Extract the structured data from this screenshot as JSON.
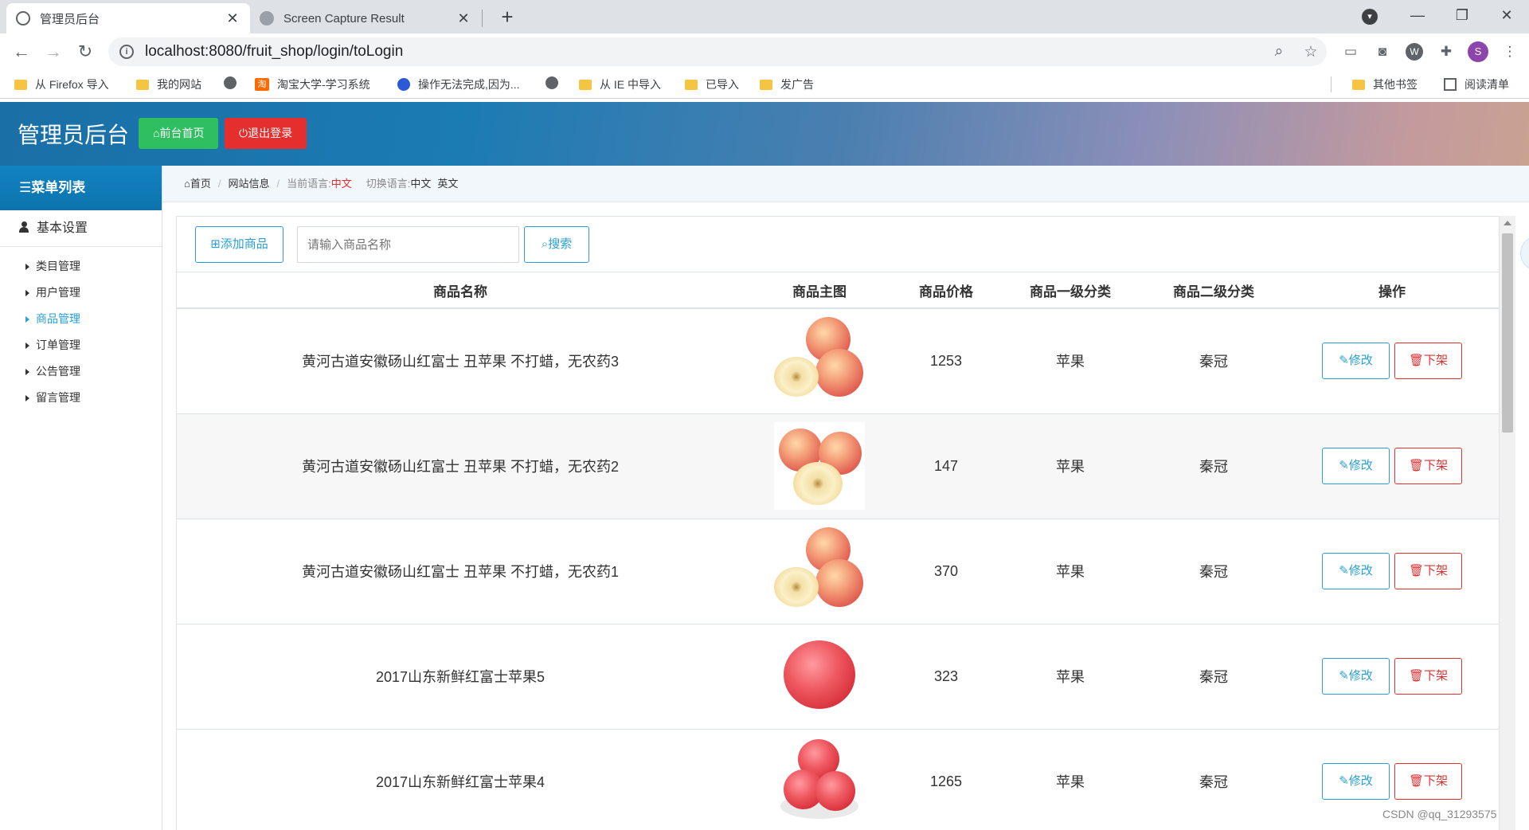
{
  "browser": {
    "tabs": [
      {
        "title": "管理员后台",
        "active": true
      },
      {
        "title": "Screen Capture Result",
        "active": false
      }
    ],
    "url": "localhost:8080/fruit_shop/login/toLogin",
    "bookmarks": [
      {
        "label": "从 Firefox 导入",
        "icon": "folder-icon"
      },
      {
        "label": "我的网站",
        "icon": "folder-icon"
      },
      {
        "label": "",
        "icon": "globe-icon"
      },
      {
        "label": "淘宝大学-学习系统",
        "icon": "taobao-icon"
      },
      {
        "label": "操作无法完成,因为...",
        "icon": "baidu-icon"
      },
      {
        "label": "",
        "icon": "globe-icon"
      },
      {
        "label": "从 IE 中导入",
        "icon": "folder-icon"
      },
      {
        "label": "已导入",
        "icon": "folder-icon"
      },
      {
        "label": "发广告",
        "icon": "folder-icon"
      }
    ],
    "other_bookmarks": "其他书签",
    "reading_list": "阅读清单",
    "profile_initial": "S"
  },
  "header": {
    "brand": "管理员后台",
    "home_button": "前台首页",
    "logout_button": "退出登录"
  },
  "sidebar": {
    "menu_title": "菜单列表",
    "group": "基本设置",
    "items": [
      {
        "label": "类目管理",
        "active": false
      },
      {
        "label": "用户管理",
        "active": false
      },
      {
        "label": "商品管理",
        "active": true
      },
      {
        "label": "订单管理",
        "active": false
      },
      {
        "label": "公告管理",
        "active": false
      },
      {
        "label": "留言管理",
        "active": false
      }
    ]
  },
  "breadcrumb": {
    "home": "首页",
    "site_info": "网站信息",
    "current_lang_label": "当前语言:",
    "current_lang": "中文",
    "switch_lang_label": "切换语言:",
    "lang_zh": "中文",
    "lang_en": "英文"
  },
  "toolbar": {
    "add_label": "添加商品",
    "search_placeholder": "请输入商品名称",
    "search_label": "搜索"
  },
  "table": {
    "headers": [
      "商品名称",
      "商品主图",
      "商品价格",
      "商品一级分类",
      "商品二级分类",
      "操作"
    ],
    "rows": [
      {
        "name": "黄河古道安徽砀山红富士 丑苹果 不打蜡，无农药3",
        "price": "1253",
        "cat1": "苹果",
        "cat2": "秦冠"
      },
      {
        "name": "黄河古道安徽砀山红富士 丑苹果 不打蜡，无农药2",
        "price": "147",
        "cat1": "苹果",
        "cat2": "秦冠"
      },
      {
        "name": "黄河古道安徽砀山红富士 丑苹果 不打蜡，无农药1",
        "price": "370",
        "cat1": "苹果",
        "cat2": "秦冠"
      },
      {
        "name": "2017山东新鲜红富士苹果5",
        "price": "323",
        "cat1": "苹果",
        "cat2": "秦冠"
      },
      {
        "name": "2017山东新鲜红富士苹果4",
        "price": "1265",
        "cat1": "苹果",
        "cat2": "秦冠"
      }
    ],
    "edit_label": "修改",
    "offshelf_label": "下架"
  },
  "watermark": "CSDN @qq_31293575"
}
